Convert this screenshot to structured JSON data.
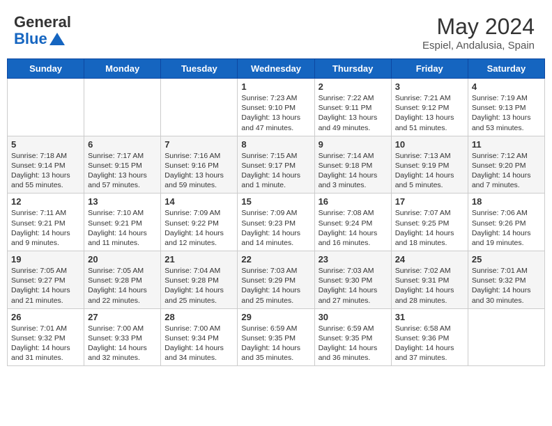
{
  "header": {
    "logo_line1": "General",
    "logo_line2": "Blue",
    "month_year": "May 2024",
    "location": "Espiel, Andalusia, Spain"
  },
  "weekdays": [
    "Sunday",
    "Monday",
    "Tuesday",
    "Wednesday",
    "Thursday",
    "Friday",
    "Saturday"
  ],
  "weeks": [
    [
      {
        "day": "",
        "text": ""
      },
      {
        "day": "",
        "text": ""
      },
      {
        "day": "",
        "text": ""
      },
      {
        "day": "1",
        "text": "Sunrise: 7:23 AM\nSunset: 9:10 PM\nDaylight: 13 hours and 47 minutes."
      },
      {
        "day": "2",
        "text": "Sunrise: 7:22 AM\nSunset: 9:11 PM\nDaylight: 13 hours and 49 minutes."
      },
      {
        "day": "3",
        "text": "Sunrise: 7:21 AM\nSunset: 9:12 PM\nDaylight: 13 hours and 51 minutes."
      },
      {
        "day": "4",
        "text": "Sunrise: 7:19 AM\nSunset: 9:13 PM\nDaylight: 13 hours and 53 minutes."
      }
    ],
    [
      {
        "day": "5",
        "text": "Sunrise: 7:18 AM\nSunset: 9:14 PM\nDaylight: 13 hours and 55 minutes."
      },
      {
        "day": "6",
        "text": "Sunrise: 7:17 AM\nSunset: 9:15 PM\nDaylight: 13 hours and 57 minutes."
      },
      {
        "day": "7",
        "text": "Sunrise: 7:16 AM\nSunset: 9:16 PM\nDaylight: 13 hours and 59 minutes."
      },
      {
        "day": "8",
        "text": "Sunrise: 7:15 AM\nSunset: 9:17 PM\nDaylight: 14 hours and 1 minute."
      },
      {
        "day": "9",
        "text": "Sunrise: 7:14 AM\nSunset: 9:18 PM\nDaylight: 14 hours and 3 minutes."
      },
      {
        "day": "10",
        "text": "Sunrise: 7:13 AM\nSunset: 9:19 PM\nDaylight: 14 hours and 5 minutes."
      },
      {
        "day": "11",
        "text": "Sunrise: 7:12 AM\nSunset: 9:20 PM\nDaylight: 14 hours and 7 minutes."
      }
    ],
    [
      {
        "day": "12",
        "text": "Sunrise: 7:11 AM\nSunset: 9:21 PM\nDaylight: 14 hours and 9 minutes."
      },
      {
        "day": "13",
        "text": "Sunrise: 7:10 AM\nSunset: 9:21 PM\nDaylight: 14 hours and 11 minutes."
      },
      {
        "day": "14",
        "text": "Sunrise: 7:09 AM\nSunset: 9:22 PM\nDaylight: 14 hours and 12 minutes."
      },
      {
        "day": "15",
        "text": "Sunrise: 7:09 AM\nSunset: 9:23 PM\nDaylight: 14 hours and 14 minutes."
      },
      {
        "day": "16",
        "text": "Sunrise: 7:08 AM\nSunset: 9:24 PM\nDaylight: 14 hours and 16 minutes."
      },
      {
        "day": "17",
        "text": "Sunrise: 7:07 AM\nSunset: 9:25 PM\nDaylight: 14 hours and 18 minutes."
      },
      {
        "day": "18",
        "text": "Sunrise: 7:06 AM\nSunset: 9:26 PM\nDaylight: 14 hours and 19 minutes."
      }
    ],
    [
      {
        "day": "19",
        "text": "Sunrise: 7:05 AM\nSunset: 9:27 PM\nDaylight: 14 hours and 21 minutes."
      },
      {
        "day": "20",
        "text": "Sunrise: 7:05 AM\nSunset: 9:28 PM\nDaylight: 14 hours and 22 minutes."
      },
      {
        "day": "21",
        "text": "Sunrise: 7:04 AM\nSunset: 9:28 PM\nDaylight: 14 hours and 25 minutes."
      },
      {
        "day": "22",
        "text": "Sunrise: 7:03 AM\nSunset: 9:29 PM\nDaylight: 14 hours and 25 minutes."
      },
      {
        "day": "23",
        "text": "Sunrise: 7:03 AM\nSunset: 9:30 PM\nDaylight: 14 hours and 27 minutes."
      },
      {
        "day": "24",
        "text": "Sunrise: 7:02 AM\nSunset: 9:31 PM\nDaylight: 14 hours and 28 minutes."
      },
      {
        "day": "25",
        "text": "Sunrise: 7:01 AM\nSunset: 9:32 PM\nDaylight: 14 hours and 30 minutes."
      }
    ],
    [
      {
        "day": "26",
        "text": "Sunrise: 7:01 AM\nSunset: 9:32 PM\nDaylight: 14 hours and 31 minutes."
      },
      {
        "day": "27",
        "text": "Sunrise: 7:00 AM\nSunset: 9:33 PM\nDaylight: 14 hours and 32 minutes."
      },
      {
        "day": "28",
        "text": "Sunrise: 7:00 AM\nSunset: 9:34 PM\nDaylight: 14 hours and 34 minutes."
      },
      {
        "day": "29",
        "text": "Sunrise: 6:59 AM\nSunset: 9:35 PM\nDaylight: 14 hours and 35 minutes."
      },
      {
        "day": "30",
        "text": "Sunrise: 6:59 AM\nSunset: 9:35 PM\nDaylight: 14 hours and 36 minutes."
      },
      {
        "day": "31",
        "text": "Sunrise: 6:58 AM\nSunset: 9:36 PM\nDaylight: 14 hours and 37 minutes."
      },
      {
        "day": "",
        "text": ""
      }
    ]
  ]
}
